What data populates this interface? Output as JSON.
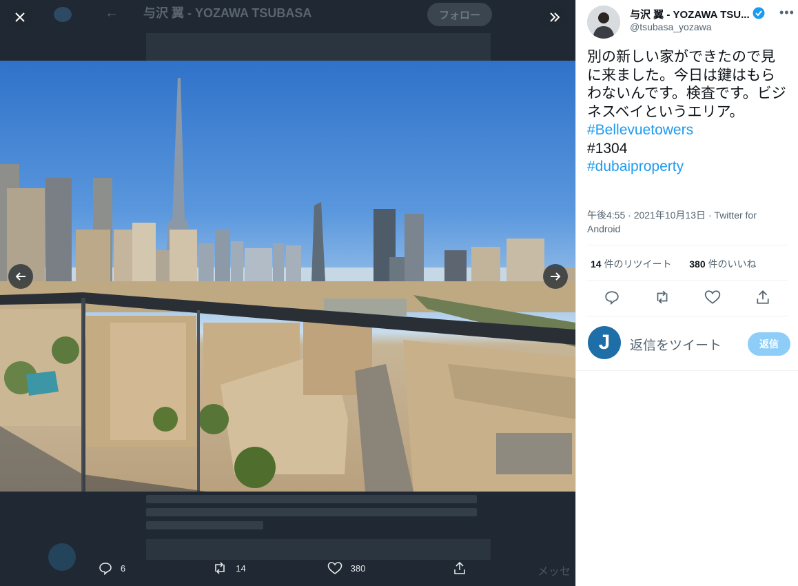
{
  "viewer": {
    "background_profile_name": "与沢 翼 - YOZAWA TSUBASA",
    "background_follow_label": "フォロー",
    "background_right_word": "メッセ",
    "close_icon": "close-icon",
    "expand_icon": "double-chevron-right-icon",
    "prev_icon": "arrow-left-icon",
    "next_icon": "arrow-right-icon",
    "actions": {
      "replies": "6",
      "retweets": "14",
      "likes": "380"
    }
  },
  "tweet": {
    "author_name": "与沢 翼 - YOZAWA TSU...",
    "handle": "@tsubasa_yozawa",
    "more_label": "•••",
    "text": "別の新しい家ができたので見に来ました。今日は鍵はもらわないんです。検査です。ビジネスベイというエリア。",
    "hashtag_1": "#Bellevuetowers",
    "number_tag": "#1304",
    "hashtag_2": "#dubaiproperty",
    "meta": "午後4:55 · 2021年10月13日 · Twitter for Android",
    "retweet_count": "14",
    "retweet_label": " 件のリツイート",
    "like_count": "380",
    "like_label": " 件のいいね",
    "reply_avatar_letter": "J",
    "reply_placeholder": "返信をツイート",
    "reply_button": "返信"
  },
  "colors": {
    "accent": "#1d9bf0",
    "viewer_bg": "#1f2833"
  }
}
